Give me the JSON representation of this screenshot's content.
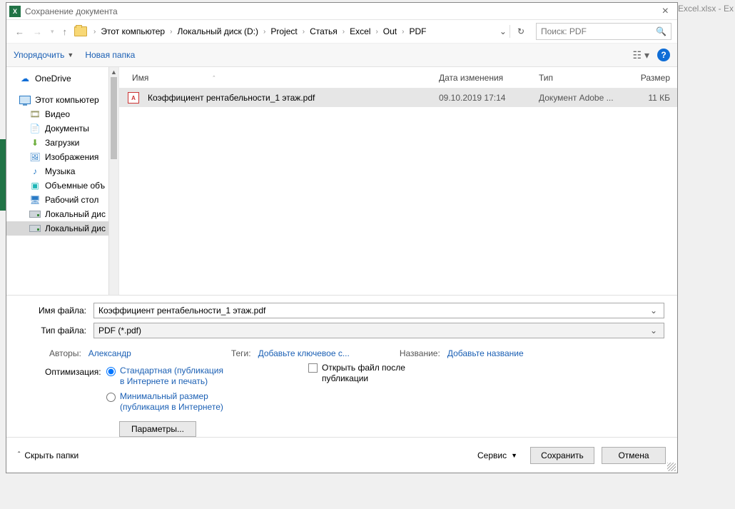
{
  "background": {
    "title_fragment": "Excel.xlsx - Ex"
  },
  "dialog": {
    "title": "Сохранение документа",
    "breadcrumb": [
      "Этот компьютер",
      "Локальный диск (D:)",
      "Project",
      "Статья",
      "Excel",
      "Out",
      "PDF"
    ],
    "search_placeholder": "Поиск: PDF",
    "toolbar": {
      "organize": "Упорядочить",
      "new_folder": "Новая папка"
    },
    "sidebar": {
      "onedrive": "OneDrive",
      "this_pc": "Этот компьютер",
      "items": [
        "Видео",
        "Документы",
        "Загрузки",
        "Изображения",
        "Музыка",
        "Объемные объ",
        "Рабочий стол",
        "Локальный дис",
        "Локальный дис"
      ]
    },
    "columns": {
      "name": "Имя",
      "date": "Дата изменения",
      "type": "Тип",
      "size": "Размер"
    },
    "file": {
      "name": "Коэффициент рентабельности_1 этаж.pdf",
      "date": "09.10.2019 17:14",
      "type": "Документ Adobe ...",
      "size": "11 КБ"
    },
    "form": {
      "name_label": "Имя файла:",
      "name_value": "Коэффициент рентабельности_1 этаж.pdf",
      "type_label": "Тип файла:",
      "type_value": "PDF (*.pdf)",
      "authors_label": "Авторы:",
      "authors_value": "Александр",
      "tags_label": "Теги:",
      "tags_value": "Добавьте ключевое с...",
      "title_label": "Название:",
      "title_value": "Добавьте название",
      "optimization_label": "Оптимизация:",
      "opt_standard": "Стандартная (публикация в Интернете и печать)",
      "opt_minimal": "Минимальный размер (публикация в Интернете)",
      "open_after": "Открыть файл после публикации",
      "params_btn": "Параметры..."
    },
    "footer": {
      "hide_folders": "Скрыть папки",
      "service": "Сервис",
      "save": "Сохранить",
      "cancel": "Отмена"
    }
  }
}
